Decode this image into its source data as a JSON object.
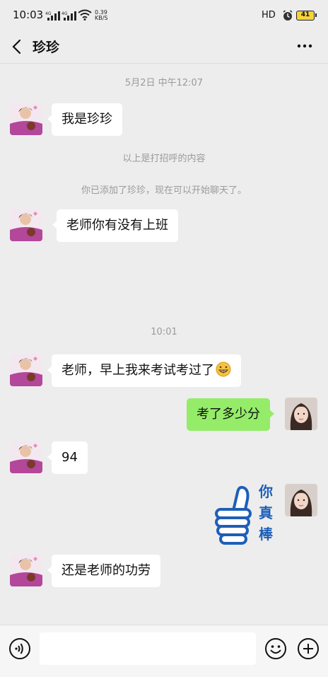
{
  "status_bar": {
    "time": "10:03",
    "network_1": "4G",
    "network_2": "4G",
    "speed_value": "0.39",
    "speed_unit": "KB/S",
    "hd_label": "HD",
    "battery": "41"
  },
  "header": {
    "title": "珍珍",
    "back_icon": "chevron-left-icon",
    "more_icon": "more-dots-icon"
  },
  "messages": {
    "ts1": "5月2日 中午12:07",
    "m1": "我是珍珍",
    "sys1": "以上是打招呼的内容",
    "sys2": "你已添加了珍珍，现在可以开始聊天了。",
    "m2": "老师你有没有上班",
    "ts2": "10:01",
    "m3": "老师，早上我来考试考过了",
    "m4": "考了多少分",
    "m5": "94",
    "sticker_text": [
      "你",
      "真",
      "棒"
    ],
    "m6": "还是老师的功劳"
  },
  "input_bar": {
    "value": "",
    "voice_icon": "voice-icon",
    "emoji_icon": "emoji-icon",
    "plus_icon": "plus-icon"
  },
  "colors": {
    "background": "#ededed",
    "self_bubble": "#95ec69",
    "other_bubble": "#ffffff",
    "sticker_blue": "#1e5fb8"
  }
}
